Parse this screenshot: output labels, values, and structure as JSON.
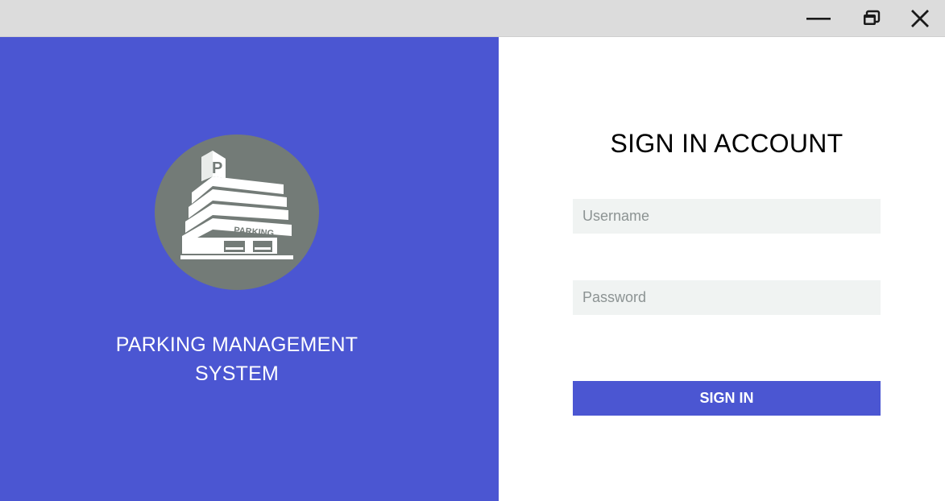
{
  "window": {
    "minimize_icon": "minimize-icon",
    "restore_icon": "restore-icon",
    "close_icon": "close-icon"
  },
  "brand": {
    "logo_icon": "parking-building-icon",
    "logo_sign_letter": "P",
    "logo_banner_text": "PARKING",
    "title_line1": "PARKING MANAGEMENT",
    "title_line2": "SYSTEM"
  },
  "login": {
    "heading": "SIGN IN ACCOUNT",
    "username": {
      "value": "",
      "placeholder": "Username"
    },
    "password": {
      "value": "",
      "placeholder": "Password"
    },
    "submit_label": "SIGN IN"
  },
  "colors": {
    "accent": "#4b56d2",
    "titlebar": "#dcdcdc",
    "logo_circle": "#737b77",
    "field_bg": "#f0f3f2"
  }
}
